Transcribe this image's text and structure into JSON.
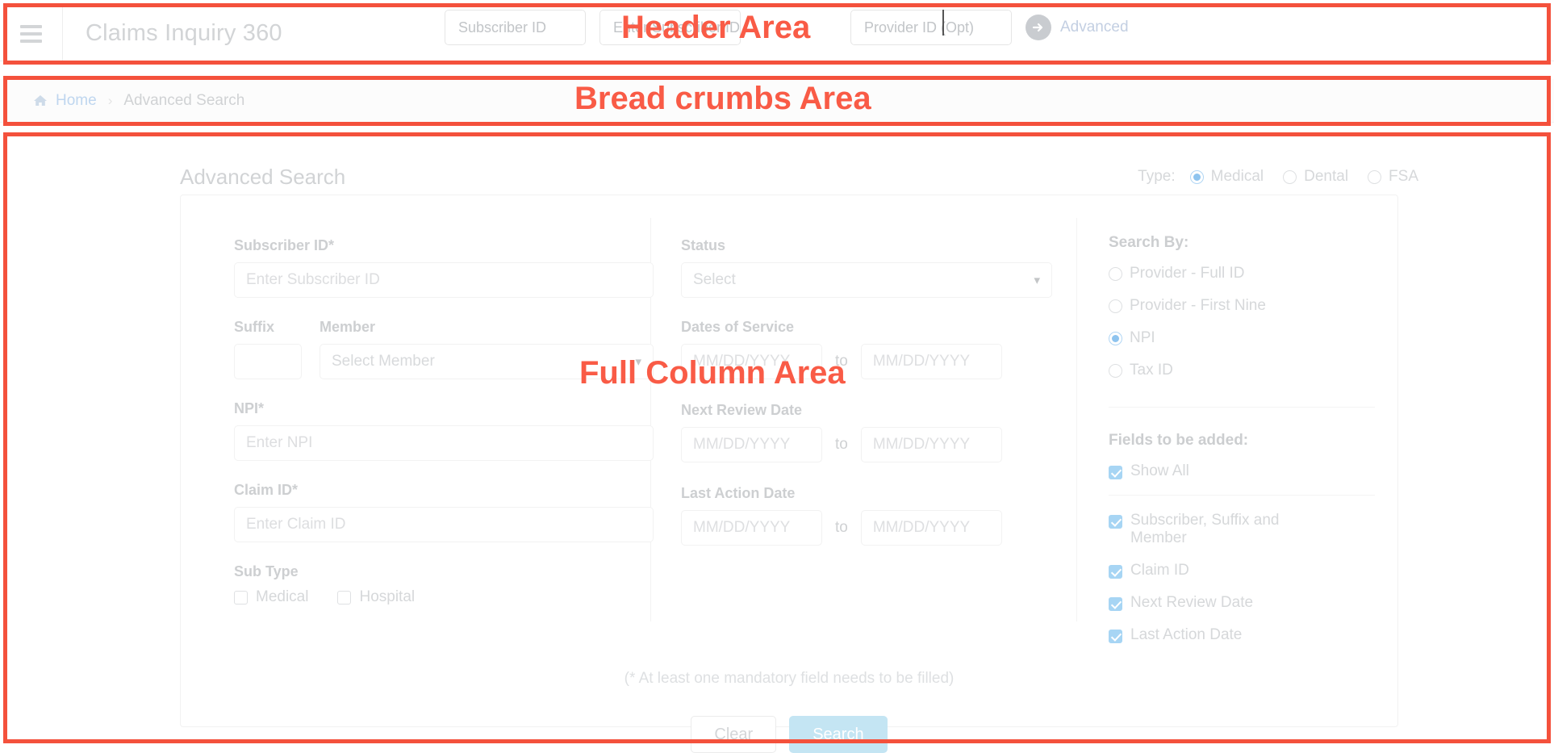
{
  "annotations": {
    "header": "Header Area",
    "breadcrumbs": "Bread crumbs Area",
    "full_column": "Full Column Area"
  },
  "header": {
    "menu_icon": "hamburger-icon",
    "app_title": "Claims Inquiry 360",
    "fields": [
      {
        "placeholder": "Subscriber ID"
      },
      {
        "placeholder": "Enter Subscriber ID"
      },
      {
        "placeholder": "Provider ID (Opt)"
      }
    ],
    "advanced_label": "Advanced",
    "advanced_icon": "arrow-right-circle-icon"
  },
  "breadcrumb": {
    "home_icon": "home-icon",
    "home": "Home",
    "separator": "›",
    "current": "Advanced Search"
  },
  "main": {
    "title": "Advanced Search",
    "type": {
      "label": "Type:",
      "options": [
        {
          "label": "Medical",
          "checked": true
        },
        {
          "label": "Dental",
          "checked": false
        },
        {
          "label": "FSA",
          "checked": false
        }
      ]
    },
    "left_column": {
      "subscriber_id": {
        "label": "Subscriber ID*",
        "placeholder": "Enter Subscriber ID",
        "value": ""
      },
      "suffix": {
        "label": "Suffix",
        "placeholder": "",
        "value": ""
      },
      "member": {
        "label": "Member",
        "placeholder": "Select Member",
        "value": ""
      },
      "npi": {
        "label": "NPI*",
        "placeholder": "Enter NPI",
        "value": ""
      },
      "claim_id": {
        "label": "Claim ID*",
        "placeholder": "Enter Claim ID",
        "value": ""
      },
      "sub_type": {
        "label": "Sub Type",
        "options": [
          {
            "label": "Medical",
            "checked": false
          },
          {
            "label": "Hospital",
            "checked": false
          }
        ]
      }
    },
    "mid_column": {
      "status": {
        "label": "Status",
        "placeholder": "Select",
        "value": ""
      },
      "dates_of_service": {
        "label": "Dates of Service",
        "from_placeholder": "MM/DD/YYYY",
        "to_word": "to",
        "to_placeholder": "MM/DD/YYYY"
      },
      "next_review_date": {
        "label": "Next Review Date",
        "from_placeholder": "MM/DD/YYYY",
        "to_word": "to",
        "to_placeholder": "MM/DD/YYYY"
      },
      "last_action_date": {
        "label": "Last Action Date",
        "from_placeholder": "MM/DD/YYYY",
        "to_word": "to",
        "to_placeholder": "MM/DD/YYYY"
      }
    },
    "right_column": {
      "search_by": {
        "label": "Search By:",
        "options": [
          {
            "label": "Provider - Full ID",
            "checked": false
          },
          {
            "label": "Provider - First Nine",
            "checked": false
          },
          {
            "label": "NPI",
            "checked": true
          },
          {
            "label": "Tax ID",
            "checked": false
          }
        ]
      },
      "fields_to_add": {
        "label": "Fields to be added:",
        "show_all": {
          "label": "Show All",
          "checked": true
        },
        "options": [
          {
            "label": "Subscriber, Suffix and Member",
            "checked": true
          },
          {
            "label": "Claim ID",
            "checked": true
          },
          {
            "label": "Next Review Date",
            "checked": true
          },
          {
            "label": "Last Action Date",
            "checked": true
          }
        ]
      }
    },
    "mandatory_note": "(* At least one mandatory field needs to be filled)",
    "buttons": {
      "clear": "Clear",
      "search": "Search"
    }
  },
  "colors": {
    "annotation": "#f4513c",
    "accent_blue": "#5aa9e8",
    "search_button": "#a9d9ee",
    "checkbox": "#7ec2ef"
  }
}
